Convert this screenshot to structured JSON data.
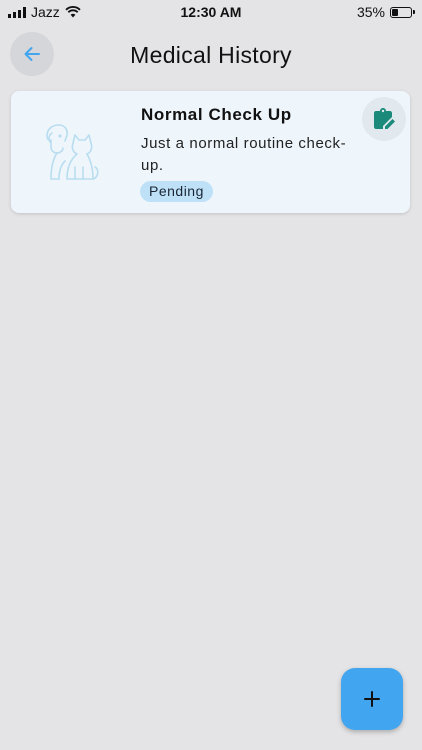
{
  "status_bar": {
    "carrier": "Jazz",
    "time": "12:30 AM",
    "battery_percent": "35%",
    "battery_level": 0.35,
    "icons": [
      "signal-icon",
      "wifi-icon",
      "battery-icon"
    ]
  },
  "header": {
    "title": "Medical History",
    "back_icon": "arrow-left-icon"
  },
  "records": [
    {
      "title": "Normal Check Up",
      "description": "Just a normal routine check-up.",
      "status": "Pending",
      "icon": "pet-silhouette-icon",
      "action_icon": "clipboard-edit-icon"
    }
  ],
  "fab": {
    "icon": "plus-icon"
  },
  "colors": {
    "background": "#e4e4e6",
    "accent": "#42a5f0",
    "card_background": "#eef6fc",
    "badge_background": "#bfe1f8",
    "edit_icon": "#1b8a7a",
    "pet_icon": "#b9ddf0"
  }
}
